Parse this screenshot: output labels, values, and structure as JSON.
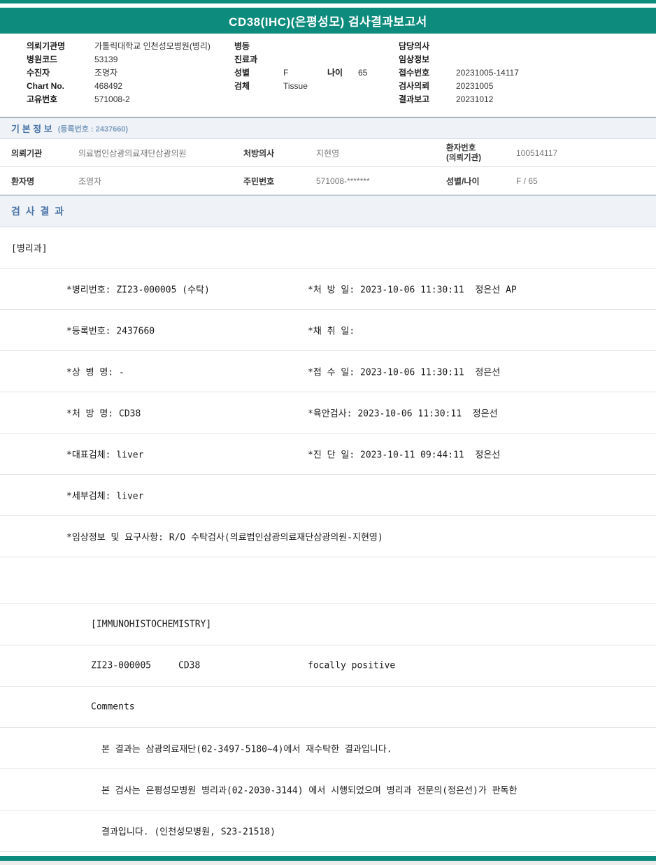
{
  "theme": {
    "teal": "#0d8b7d",
    "section_title_blue": "#4b74a6",
    "section_bg": "#eff3f7"
  },
  "report_title": "CD38(IHC)(은평성모) 검사결과보고서",
  "patient_header": {
    "left_fields": [
      {
        "label": "의뢰기관명",
        "value": "가톨릭대학교 인천성모병원(병리)"
      },
      {
        "label": "병원코드",
        "value": "53139"
      },
      {
        "label": "수진자",
        "value": "조명자"
      },
      {
        "label": "Chart No.",
        "value": "468492"
      },
      {
        "label": "고유번호",
        "value": "571008-2"
      }
    ],
    "middle": {
      "ward_label": "병동",
      "ward_value": "",
      "dept_label": "진료과",
      "dept_value": "",
      "sex_label": "성별",
      "sex_value": "F",
      "age_label": "나이",
      "age_value": "65",
      "specimen_label": "검체",
      "specimen_value": "Tissue"
    },
    "right_fields": [
      {
        "label": "담당의사",
        "value": ""
      },
      {
        "label": "임상정보",
        "value": ""
      },
      {
        "label": "접수번호",
        "value": "20231005-14117"
      },
      {
        "label": "검사의뢰",
        "value": "20231005"
      },
      {
        "label": "결과보고",
        "value": "20231012"
      }
    ]
  },
  "basic_info": {
    "title": "기 본 정 보",
    "subtitle": "(등록번호 : 2437660)",
    "row1": {
      "label1": "의뢰기관",
      "value1": "의료법인삼광의료재단삼광의원",
      "label2": "처방의사",
      "value2": "지현영",
      "label3": "환자번호",
      "label3_sub": "(의뢰기관)",
      "value3": "100514117"
    },
    "row2": {
      "label1": "환자명",
      "value1": "조명자",
      "label2": "주민번호",
      "value2": "571008-*******",
      "label3": "성별/나이",
      "value3": "F / 65"
    }
  },
  "results": {
    "title": "검 사 결 과",
    "department": "[병리과]",
    "fields": [
      {
        "left": "*병리번호: ZI23-000005 (수탁)",
        "right": "*처 방 일: 2023-10-06 11:30:11  정은선 AP"
      },
      {
        "left": "*등록번호: 2437660",
        "right": "*채 취 일:"
      },
      {
        "left": "*상 병 명: -",
        "right": "*접 수 일: 2023-10-06 11:30:11  정은선"
      },
      {
        "left": "*처 방 명: CD38",
        "right": "*육안검사: 2023-10-06 11:30:11  정은선"
      },
      {
        "left": "*대표검체: liver",
        "right": "*진 단 일: 2023-10-11 09:44:11  정은선"
      },
      {
        "left": "*세부검체: liver",
        "right": ""
      },
      {
        "left": "*임상정보 및 요구사항: R/O 수탁검사(의료법인삼광의료재단삼광의원-지현영)",
        "right": ""
      }
    ],
    "ihc_header": "[IMMUNOHISTOCHEMISTRY]",
    "ihc_row": {
      "specimen_no": "ZI23-000005",
      "test_name": "CD38",
      "result_value": "focally positive"
    },
    "comments_label": "Comments",
    "comment_lines": [
      "본 결과는 삼광의료재단(02-3497-5180~4)에서 재수탁한 결과입니다.",
      "본 검사는 은평성모병원 병리과(02-2030-3144) 에서 시행되었으며 병리과 전문의(정은선)가 판독한",
      "결과입니다. (인천성모병원, S23-21518)"
    ]
  }
}
